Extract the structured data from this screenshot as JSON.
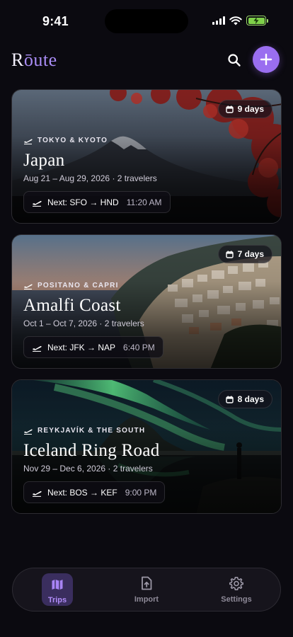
{
  "status_bar": {
    "time": "9:41"
  },
  "header": {
    "logo_prefix": "R",
    "logo_accent": "ōute",
    "search_icon": "search-icon",
    "add_icon": "plus-icon"
  },
  "colors": {
    "accent": "#9a6ef0",
    "background": "#0b0a10",
    "tab_active": "#b08cf7"
  },
  "trips": [
    {
      "days": "9 days",
      "subtitle": "TOKYO & KYOTO",
      "title": "Japan",
      "meta": "Aug 21 – Aug 29, 2026 · 2 travelers",
      "next_label": "Next: SFO → HND",
      "next_time": "11:20 AM"
    },
    {
      "days": "7 days",
      "subtitle": "POSITANO & CAPRI",
      "title": "Amalfi Coast",
      "meta": "Oct 1 – Oct 7, 2026 · 2 travelers",
      "next_label": "Next: JFK → NAP",
      "next_time": "6:40 PM"
    },
    {
      "days": "8 days",
      "subtitle": "REYKJAVÍK & THE SOUTH",
      "title": "Iceland Ring Road",
      "meta": "Nov 29 – Dec 6, 2026 · 2 travelers",
      "next_label": "Next: BOS → KEF",
      "next_time": "9:00 PM"
    }
  ],
  "tabs": [
    {
      "label": "Trips",
      "icon": "map-icon",
      "active": true
    },
    {
      "label": "Import",
      "icon": "file-upload-icon",
      "active": false
    },
    {
      "label": "Settings",
      "icon": "gear-icon",
      "active": false
    }
  ]
}
